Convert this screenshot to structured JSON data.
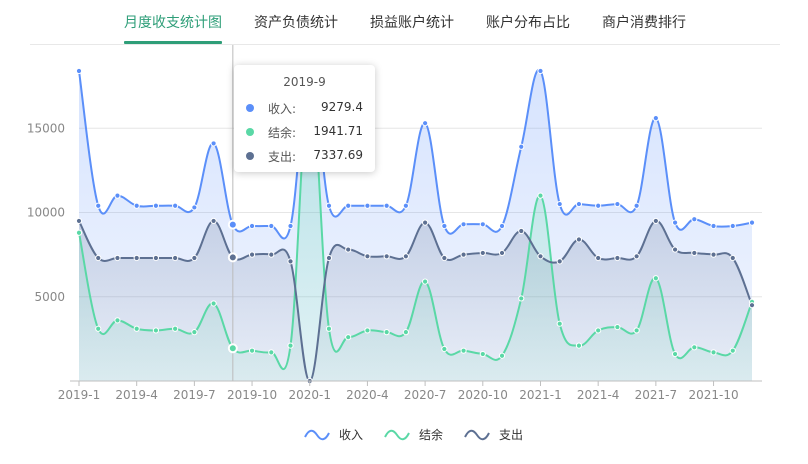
{
  "tabs": [
    {
      "label": "月度收支统计图",
      "active": true
    },
    {
      "label": "资产负债统计",
      "active": false
    },
    {
      "label": "损益账户统计",
      "active": false
    },
    {
      "label": "账户分布占比",
      "active": false
    },
    {
      "label": "商户消费排行",
      "active": false
    }
  ],
  "colors": {
    "accent": "#2e9e78",
    "income": "#5b8ff9",
    "balance": "#5ad8a6",
    "expense": "#5d7092"
  },
  "tooltip": {
    "title": "2019-9",
    "rows": [
      {
        "label": "收入:",
        "value": "9279.4"
      },
      {
        "label": "结余:",
        "value": "1941.71"
      },
      {
        "label": "支出:",
        "value": "7337.69"
      }
    ]
  },
  "chart_data": {
    "type": "area",
    "x": [
      "2019-1",
      "2019-2",
      "2019-3",
      "2019-4",
      "2019-5",
      "2019-6",
      "2019-7",
      "2019-8",
      "2019-9",
      "2019-10",
      "2019-11",
      "2019-12",
      "2020-1",
      "2020-2",
      "2020-3",
      "2020-4",
      "2020-5",
      "2020-6",
      "2020-7",
      "2020-8",
      "2020-9",
      "2020-10",
      "2020-11",
      "2020-12",
      "2021-1",
      "2021-2",
      "2021-3",
      "2021-4",
      "2021-5",
      "2021-6",
      "2021-7",
      "2021-8",
      "2021-9",
      "2021-10",
      "2021-11",
      "2021-12"
    ],
    "x_tick_labels": [
      "2019-1",
      "2019-4",
      "2019-7",
      "2019-10",
      "2020-1",
      "2020-4",
      "2020-7",
      "2020-10",
      "2021-1",
      "2021-4",
      "2021-7",
      "2021-10"
    ],
    "y_tick_labels": [
      "5000",
      "10000",
      "15000"
    ],
    "ylim": [
      0,
      20000
    ],
    "grid": true,
    "legend_position": "bottom",
    "series": [
      {
        "name": "收入",
        "values": [
          18400,
          10400,
          11000,
          10400,
          10400,
          10400,
          10300,
          14100,
          9279.4,
          9200,
          9200,
          9200,
          18500,
          10400,
          10400,
          10400,
          10400,
          10400,
          15300,
          9200,
          9300,
          9300,
          9200,
          13900,
          18400,
          10500,
          10500,
          10400,
          10500,
          10400,
          15600,
          9400,
          9600,
          9200,
          9200,
          9400
        ]
      },
      {
        "name": "结余",
        "values": [
          8800,
          3100,
          3600,
          3100,
          3000,
          3100,
          2900,
          4600,
          1941.71,
          1800,
          1700,
          2100,
          17900,
          3100,
          2600,
          3000,
          2900,
          2900,
          5900,
          1900,
          1800,
          1600,
          1500,
          4900,
          11000,
          3400,
          2100,
          3000,
          3200,
          3000,
          6100,
          1600,
          2000,
          1700,
          1800,
          4700
        ]
      },
      {
        "name": "支出",
        "values": [
          9500,
          7300,
          7300,
          7300,
          7300,
          7300,
          7300,
          9500,
          7337.69,
          7500,
          7500,
          7100,
          0,
          7300,
          7800,
          7400,
          7400,
          7400,
          9400,
          7300,
          7500,
          7600,
          7600,
          8900,
          7400,
          7100,
          8400,
          7300,
          7300,
          7400,
          9500,
          7800,
          7600,
          7500,
          7300,
          4500
        ]
      }
    ]
  }
}
